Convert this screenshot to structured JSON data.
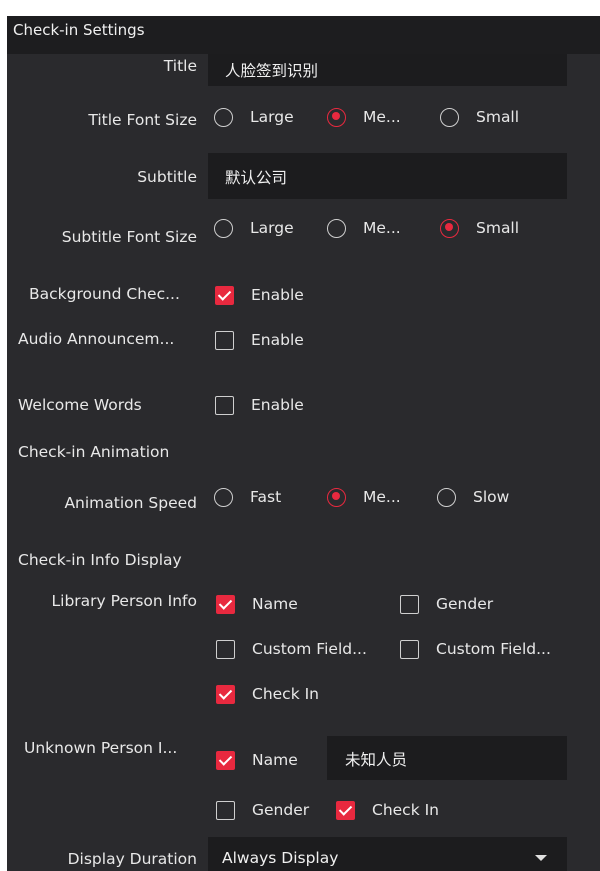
{
  "header": {
    "title": "Check-in Settings"
  },
  "title_field": {
    "label": "Title",
    "value": "人脸签到识别"
  },
  "title_font_size": {
    "label": "Title Font Size",
    "options": [
      "Large",
      "Me...",
      "Small"
    ],
    "selected": "Me..."
  },
  "subtitle_field": {
    "label": "Subtitle",
    "value": "默认公司"
  },
  "subtitle_font_size": {
    "label": "Subtitle Font Size",
    "options": [
      "Large",
      "Me...",
      "Small"
    ],
    "selected": "Small"
  },
  "background_check": {
    "label": "Background Chec...",
    "option": "Enable",
    "checked": true
  },
  "audio_announcement": {
    "label": "Audio Announcem...",
    "option": "Enable",
    "checked": false
  },
  "welcome_words": {
    "label": "Welcome Words",
    "option": "Enable",
    "checked": false
  },
  "checkin_animation": {
    "section": "Check-in Animation"
  },
  "animation_speed": {
    "label": "Animation Speed",
    "options": [
      "Fast",
      "Me...",
      "Slow"
    ],
    "selected": "Me..."
  },
  "checkin_info_display": {
    "section": "Check-in Info Display"
  },
  "library_person_info": {
    "label": "Library Person Info",
    "options": [
      {
        "text": "Name",
        "checked": true
      },
      {
        "text": "Gender",
        "checked": false
      },
      {
        "text": "Custom Field...",
        "checked": false
      },
      {
        "text": "Custom Field...",
        "checked": false
      },
      {
        "text": "Check In",
        "checked": true
      }
    ]
  },
  "unknown_person_info": {
    "label": "Unknown Person I...",
    "name": {
      "text": "Name",
      "checked": true,
      "value": "未知人员"
    },
    "gender": {
      "text": "Gender",
      "checked": false
    },
    "check_in": {
      "text": "Check In",
      "checked": true
    }
  },
  "display_duration": {
    "label": "Display Duration",
    "value": "Always Display"
  },
  "colors": {
    "panel_bg": "#2a2a2d",
    "field_bg": "#1c1c1e",
    "accent": "#e8293f",
    "text": "#e8e8e8"
  }
}
